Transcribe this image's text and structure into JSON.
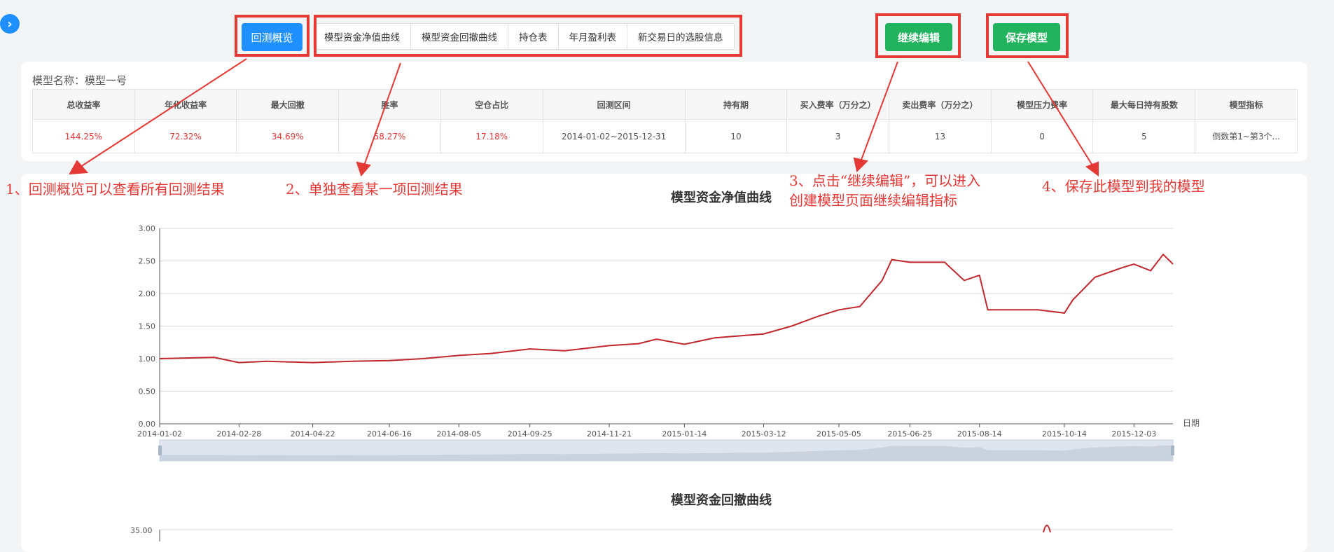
{
  "toolbar": {
    "overview_label": "回测概览",
    "tabs": [
      "模型资金净值曲线",
      "模型资金回撤曲线",
      "持仓表",
      "年月盈利表",
      "新交易日的选股信息"
    ],
    "continue_edit_label": "继续编辑",
    "save_model_label": "保存模型"
  },
  "summary": {
    "model_name_label": "模型名称：",
    "model_name": "模型一号",
    "columns": [
      "总收益率",
      "年化收益率",
      "最大回撤",
      "胜率",
      "空仓占比",
      "回测区间",
      "持有期",
      "买入费率（万分之）",
      "卖出费率（万分之）",
      "模型压力费率",
      "最大每日持有股数",
      "模型指标"
    ],
    "row": [
      "144.25%",
      "72.32%",
      "34.69%",
      "58.27%",
      "17.18%",
      "2014-01-02~2015-12-31",
      "10",
      "3",
      "13",
      "0",
      "5",
      "倒数第1~第3个..."
    ]
  },
  "annotations": {
    "a1": "1、回测概览可以查看所有回测结果",
    "a2": "2、单独查看某一项回测结果",
    "a3_line1": "3、点击“继续编辑”，可以进入",
    "a3_line2": "创建模型页面继续编辑指标",
    "a4": "4、保存此模型到我的模型"
  },
  "colors": {
    "accent_blue": "#1e90ff",
    "accent_green": "#22b35e",
    "annotation_red": "#e53935",
    "line_red": "#c0282d"
  },
  "icons": {
    "sidebar_toggle": "chevron-right-icon"
  },
  "chart_data": [
    {
      "type": "line",
      "title": "模型资金净值曲线",
      "xlabel": "日期",
      "ylabel": "",
      "ylim": [
        0,
        3
      ],
      "yticks": [
        "0.00",
        "0.50",
        "1.00",
        "1.50",
        "2.00",
        "2.50",
        "3.00"
      ],
      "xticks": [
        "2014-01-02",
        "2014-02-28",
        "2014-04-22",
        "2014-06-16",
        "2014-08-05",
        "2014-09-25",
        "2014-11-21",
        "2015-01-14",
        "2015-03-12",
        "2015-05-05",
        "2015-06-25",
        "2015-08-14",
        "2015-10-14",
        "2015-12-03"
      ],
      "grid": true,
      "series": [
        {
          "x": [
            "2014-01-02",
            "2014-02-10",
            "2014-02-28",
            "2014-03-20",
            "2014-04-22",
            "2014-05-20",
            "2014-06-16",
            "2014-07-10",
            "2014-08-05",
            "2014-08-28",
            "2014-09-25",
            "2014-10-20",
            "2014-11-21",
            "2014-12-12",
            "2014-12-25",
            "2015-01-14",
            "2015-02-05",
            "2015-03-12",
            "2015-04-01",
            "2015-04-20",
            "2015-05-05",
            "2015-05-20",
            "2015-06-05",
            "2015-06-12",
            "2015-06-25",
            "2015-07-20",
            "2015-08-03",
            "2015-08-14",
            "2015-08-20",
            "2015-09-25",
            "2015-10-14",
            "2015-10-20",
            "2015-11-05",
            "2015-11-25",
            "2015-12-03",
            "2015-12-15",
            "2015-12-24",
            "2015-12-31"
          ],
          "y": [
            1.0,
            1.02,
            0.94,
            0.96,
            0.94,
            0.96,
            0.97,
            1.0,
            1.05,
            1.08,
            1.15,
            1.12,
            1.2,
            1.23,
            1.3,
            1.22,
            1.32,
            1.38,
            1.5,
            1.65,
            1.75,
            1.8,
            2.2,
            2.52,
            2.48,
            2.48,
            2.2,
            2.28,
            1.75,
            1.75,
            1.7,
            1.9,
            2.25,
            2.4,
            2.45,
            2.35,
            2.6,
            2.45
          ]
        }
      ]
    },
    {
      "type": "line",
      "title": "模型资金回撤曲线",
      "ylabel": "",
      "yticks": [
        "35.00"
      ]
    }
  ]
}
